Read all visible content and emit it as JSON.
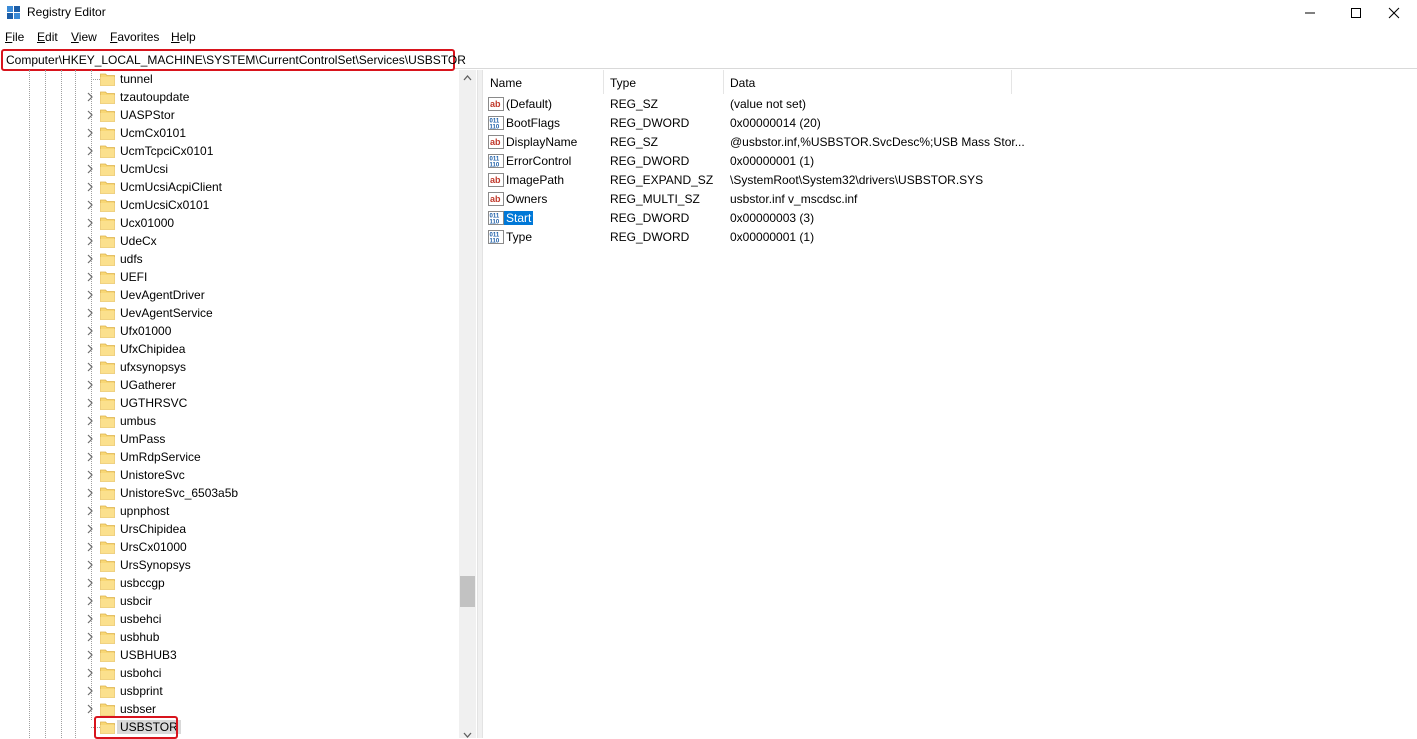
{
  "window": {
    "title": "Registry Editor",
    "controls": {
      "minimize": "minimize-icon",
      "maximize": "maximize-icon",
      "close": "close-icon"
    }
  },
  "menu": [
    {
      "label": "File",
      "underline": "F",
      "rest": "ile"
    },
    {
      "label": "Edit",
      "underline": "E",
      "rest": "dit"
    },
    {
      "label": "View",
      "underline": "V",
      "rest": "iew"
    },
    {
      "label": "Favorites",
      "underline": "F",
      "rest": "avorites"
    },
    {
      "label": "Help",
      "underline": "H",
      "rest": "elp"
    }
  ],
  "address": {
    "path": "Computer\\HKEY_LOCAL_MACHINE\\SYSTEM\\CurrentControlSet\\Services\\USBSTOR",
    "highlight_color": "#d8141d"
  },
  "tree": {
    "items": [
      {
        "label": "tunnel",
        "expandable": false
      },
      {
        "label": "tzautoupdate",
        "expandable": true
      },
      {
        "label": "UASPStor",
        "expandable": true
      },
      {
        "label": "UcmCx0101",
        "expandable": true
      },
      {
        "label": "UcmTcpciCx0101",
        "expandable": true
      },
      {
        "label": "UcmUcsi",
        "expandable": true
      },
      {
        "label": "UcmUcsiAcpiClient",
        "expandable": true
      },
      {
        "label": "UcmUcsiCx0101",
        "expandable": true
      },
      {
        "label": "Ucx01000",
        "expandable": true
      },
      {
        "label": "UdeCx",
        "expandable": true
      },
      {
        "label": "udfs",
        "expandable": true
      },
      {
        "label": "UEFI",
        "expandable": true
      },
      {
        "label": "UevAgentDriver",
        "expandable": true
      },
      {
        "label": "UevAgentService",
        "expandable": true
      },
      {
        "label": "Ufx01000",
        "expandable": true
      },
      {
        "label": "UfxChipidea",
        "expandable": true
      },
      {
        "label": "ufxsynopsys",
        "expandable": true
      },
      {
        "label": "UGatherer",
        "expandable": true
      },
      {
        "label": "UGTHRSVC",
        "expandable": true
      },
      {
        "label": "umbus",
        "expandable": true
      },
      {
        "label": "UmPass",
        "expandable": true
      },
      {
        "label": "UmRdpService",
        "expandable": true
      },
      {
        "label": "UnistoreSvc",
        "expandable": true
      },
      {
        "label": "UnistoreSvc_6503a5b",
        "expandable": true
      },
      {
        "label": "upnphost",
        "expandable": true
      },
      {
        "label": "UrsChipidea",
        "expandable": true
      },
      {
        "label": "UrsCx01000",
        "expandable": true
      },
      {
        "label": "UrsSynopsys",
        "expandable": true
      },
      {
        "label": "usbccgp",
        "expandable": true
      },
      {
        "label": "usbcir",
        "expandable": true
      },
      {
        "label": "usbehci",
        "expandable": true
      },
      {
        "label": "usbhub",
        "expandable": true
      },
      {
        "label": "USBHUB3",
        "expandable": true
      },
      {
        "label": "usbohci",
        "expandable": true
      },
      {
        "label": "usbprint",
        "expandable": true
      },
      {
        "label": "usbser",
        "expandable": true
      },
      {
        "label": "USBSTOR",
        "expandable": false,
        "selected": true
      }
    ]
  },
  "list": {
    "columns": [
      "Name",
      "Type",
      "Data"
    ],
    "rows": [
      {
        "name": "(Default)",
        "type": "REG_SZ",
        "data": "(value not set)",
        "icon": "string-value-icon"
      },
      {
        "name": "BootFlags",
        "type": "REG_DWORD",
        "data": "0x00000014 (20)",
        "icon": "binary-value-icon"
      },
      {
        "name": "DisplayName",
        "type": "REG_SZ",
        "data": "@usbstor.inf,%USBSTOR.SvcDesc%;USB Mass Stor...",
        "icon": "string-value-icon"
      },
      {
        "name": "ErrorControl",
        "type": "REG_DWORD",
        "data": "0x00000001 (1)",
        "icon": "binary-value-icon"
      },
      {
        "name": "ImagePath",
        "type": "REG_EXPAND_SZ",
        "data": "\\SystemRoot\\System32\\drivers\\USBSTOR.SYS",
        "icon": "string-value-icon"
      },
      {
        "name": "Owners",
        "type": "REG_MULTI_SZ",
        "data": "usbstor.inf v_mscdsc.inf",
        "icon": "string-value-icon"
      },
      {
        "name": "Start",
        "type": "REG_DWORD",
        "data": "0x00000003 (3)",
        "icon": "binary-value-icon",
        "selected": true
      },
      {
        "name": "Type",
        "type": "REG_DWORD",
        "data": "0x00000001 (1)",
        "icon": "binary-value-icon"
      }
    ]
  },
  "colors": {
    "selection": "#0078d7",
    "highlight": "#d8141d",
    "folder": "#f8d775"
  }
}
